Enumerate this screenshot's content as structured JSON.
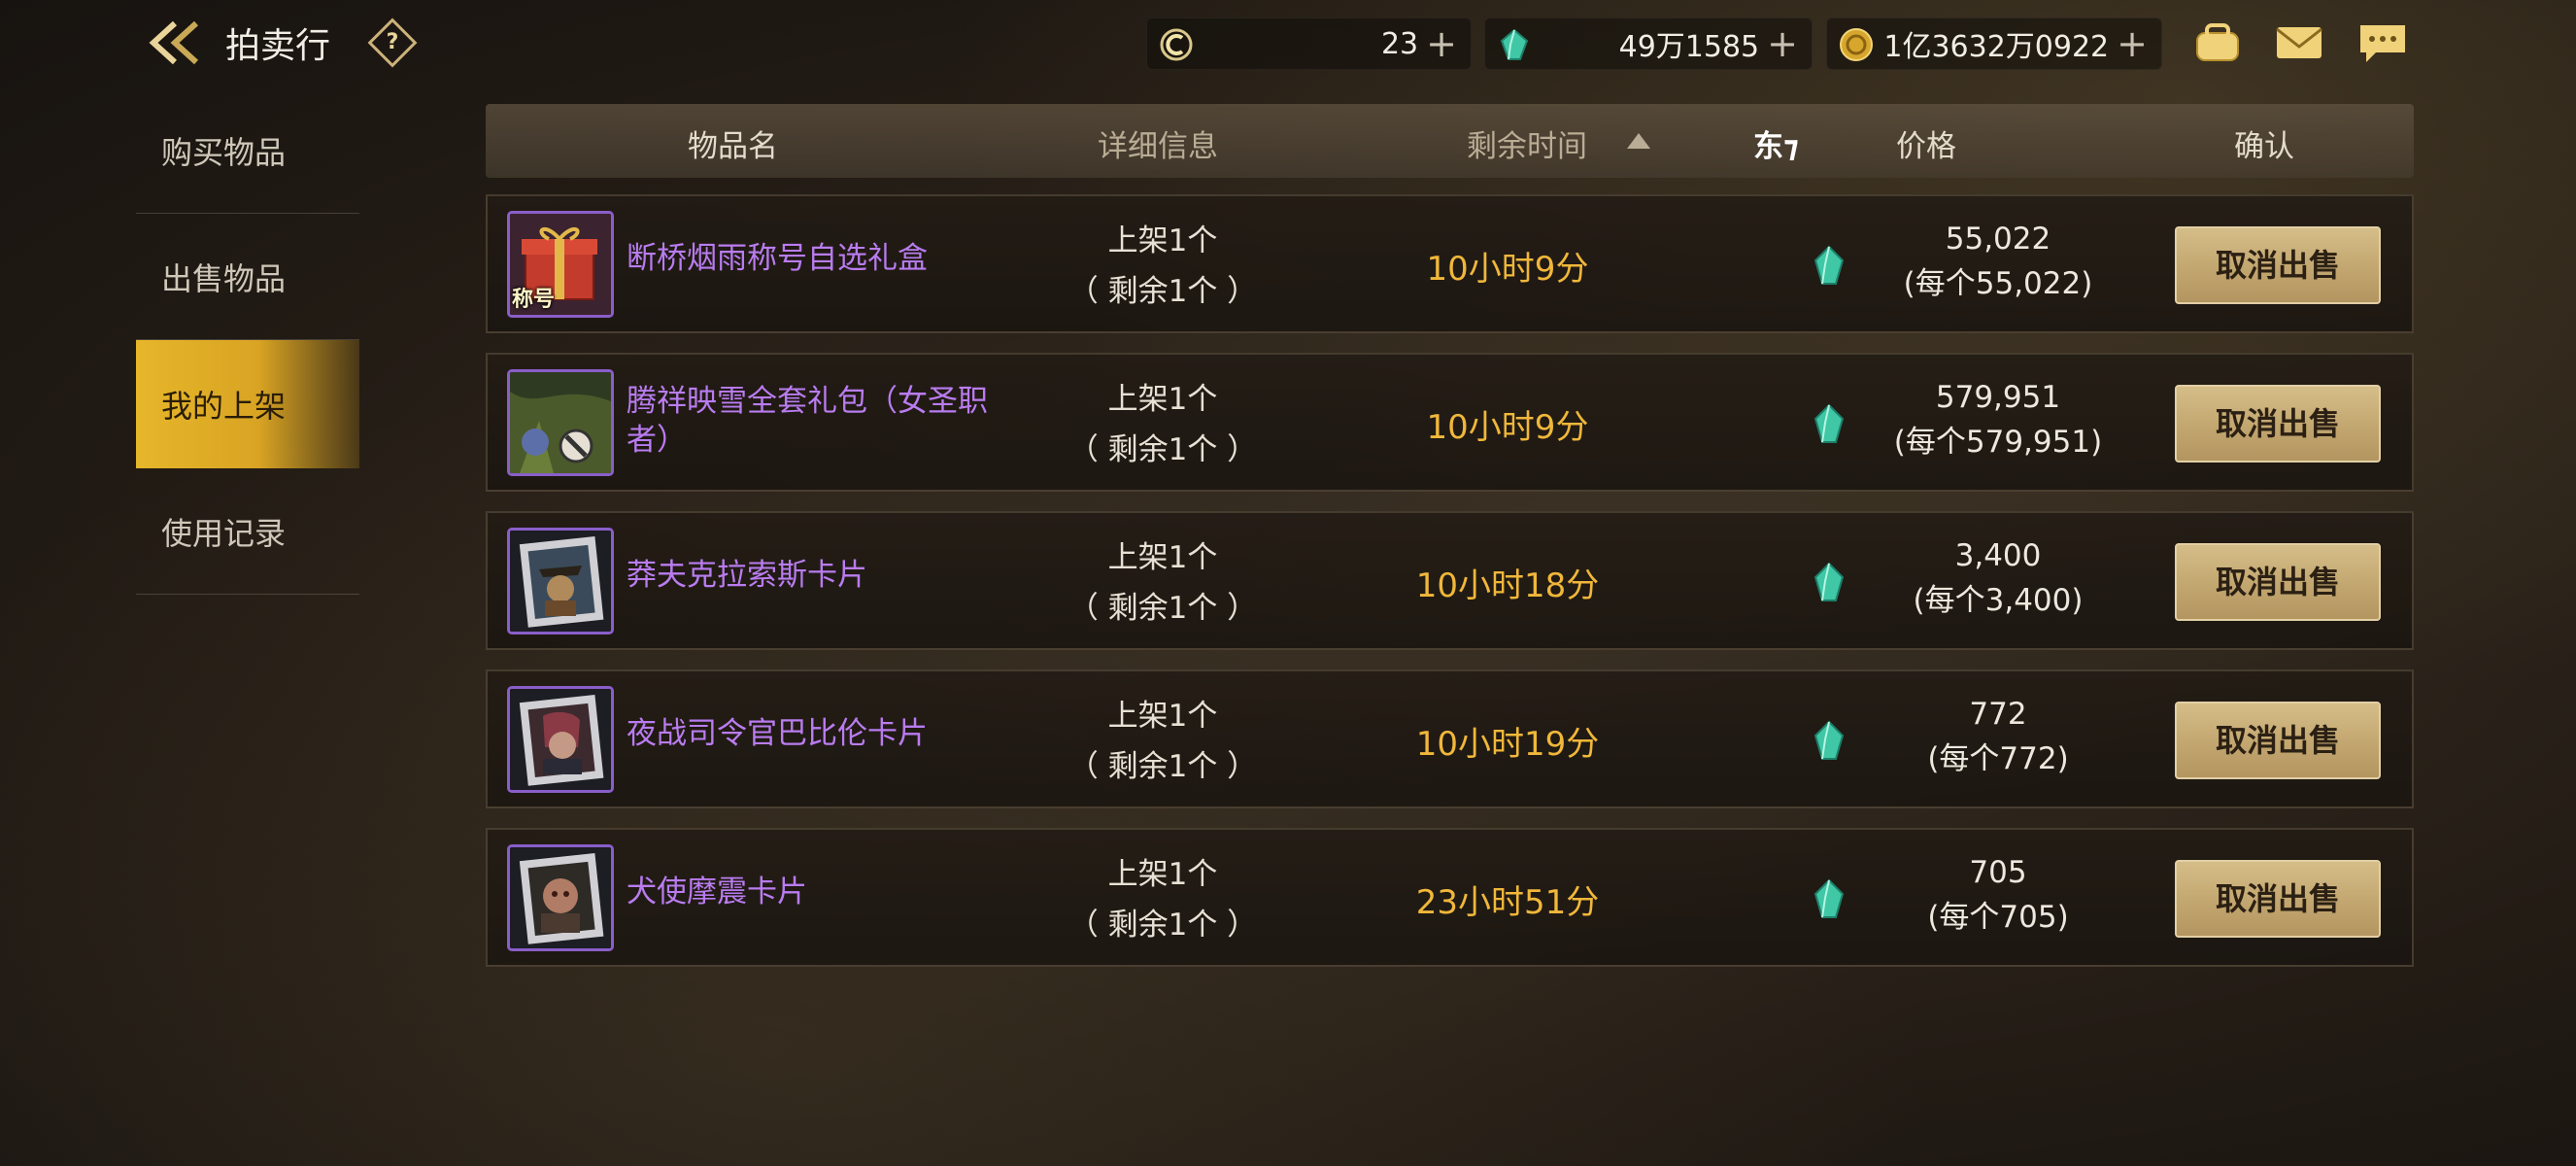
{
  "header": {
    "title": "拍卖行",
    "help_label": "?",
    "currencies": {
      "c_coin": {
        "value": "23",
        "icon": "c-coin-icon"
      },
      "gem": {
        "value": "49万1585",
        "icon": "gem-icon"
      },
      "gold": {
        "value": "1亿3632万0922",
        "icon": "gold-coin-icon"
      }
    },
    "plus": "+"
  },
  "sidebar": {
    "items": [
      {
        "label": "购买物品"
      },
      {
        "label": "出售物品"
      },
      {
        "label": "我的上架"
      },
      {
        "label": "使用记录"
      }
    ],
    "active": 2
  },
  "table": {
    "columns": {
      "name": "物品名",
      "detail": "详细信息",
      "time": "剩余时间",
      "overlay": "东⁊",
      "price": "价格",
      "confirm": "确认"
    },
    "rows": [
      {
        "name": "断桥烟雨称号自选礼盒",
        "tag": "称号",
        "listed": "上架1个",
        "remaining": "（ 剩余1个 ）",
        "time": "10小时9分",
        "price": "55,022",
        "unit_price": "(每个55,022)",
        "action": "取消出售"
      },
      {
        "name": "腾祥映雪全套礼包（女圣职者）",
        "tag": "",
        "listed": "上架1个",
        "remaining": "（ 剩余1个 ）",
        "time": "10小时9分",
        "price": "579,951",
        "unit_price": "(每个579,951)",
        "action": "取消出售"
      },
      {
        "name": "莽夫克拉索斯卡片",
        "tag": "",
        "listed": "上架1个",
        "remaining": "（ 剩余1个 ）",
        "time": "10小时18分",
        "price": "3,400",
        "unit_price": "(每个3,400)",
        "action": "取消出售"
      },
      {
        "name": "夜战司令官巴比伦卡片",
        "tag": "",
        "listed": "上架1个",
        "remaining": "（ 剩余1个 ）",
        "time": "10小时19分",
        "price": "772",
        "unit_price": "(每个772)",
        "action": "取消出售"
      },
      {
        "name": "犬使摩震卡片",
        "tag": "",
        "listed": "上架1个",
        "remaining": "（ 剩余1个 ）",
        "time": "23小时51分",
        "price": "705",
        "unit_price": "(每个705)",
        "action": "取消出售"
      }
    ]
  },
  "colors": {
    "accent_gold": "#e6b62a",
    "item_purple": "#b97cf0",
    "time_orange": "#f0b73a",
    "button_tan": "#c4a871"
  }
}
